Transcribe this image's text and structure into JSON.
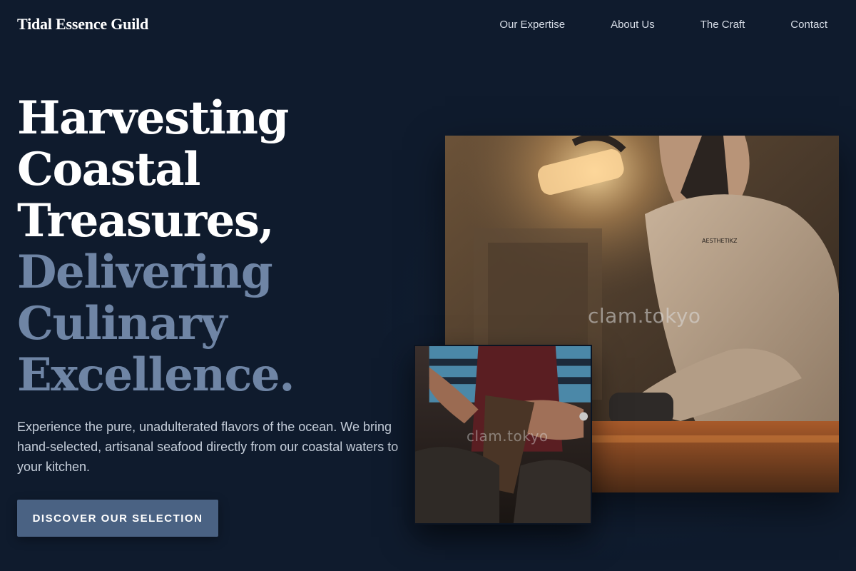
{
  "header": {
    "logo": "Tidal Essence Guild",
    "nav": [
      "Our Expertise",
      "About Us",
      "The Craft",
      "Contact"
    ]
  },
  "hero": {
    "title_lines_bright": [
      "Harvesting",
      "Coastal",
      "Treasures,"
    ],
    "title_lines_muted": [
      "Delivering",
      "Culinary",
      "Excellence."
    ],
    "description": "Experience the pure, unadulterated flavors of the ocean. We bring hand-selected, artisanal seafood directly from our coastal waters to your kitchen.",
    "cta_label": "DISCOVER OUR SELECTION"
  },
  "images": {
    "main_watermark": "clam.tokyo",
    "small_watermark": "clam.tokyo",
    "sweatshirt_text": "AESTHETIKZ"
  },
  "colors": {
    "background": "#0f1b2d",
    "title_bright": "#ffffff",
    "title_muted": "#6f85a5",
    "cta_background": "#4a6283"
  }
}
